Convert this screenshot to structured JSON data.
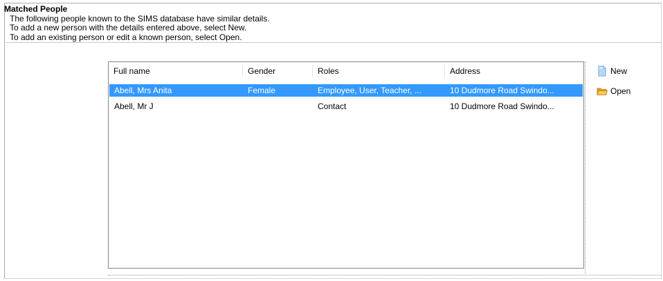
{
  "section": {
    "title": "Matched People",
    "lines": [
      "The following people known to the SIMS database have similar details.",
      "To add a new person with the details entered above, select New.",
      "To add an existing person or edit a known person, select Open."
    ]
  },
  "table": {
    "columns": [
      "Full name",
      "Gender",
      "Roles",
      "Address"
    ],
    "rows": [
      {
        "name": "Abell, Mrs Anita",
        "gender": "Female",
        "roles": "Employee, User, Teacher, ...",
        "address": "10 Dudmore Road Swindo...",
        "selected": true
      },
      {
        "name": "Abell, Mr J",
        "gender": "",
        "roles": "Contact",
        "address": "10 Dudmore Road Swindo...",
        "selected": false
      }
    ]
  },
  "actions": {
    "new_label": "New",
    "open_label": "Open"
  },
  "colors": {
    "selection": "#3399ff",
    "folder": "#f0b43a",
    "document": "#5aa0e6"
  },
  "icons": {
    "new": "new-document-icon",
    "open": "open-folder-icon"
  }
}
